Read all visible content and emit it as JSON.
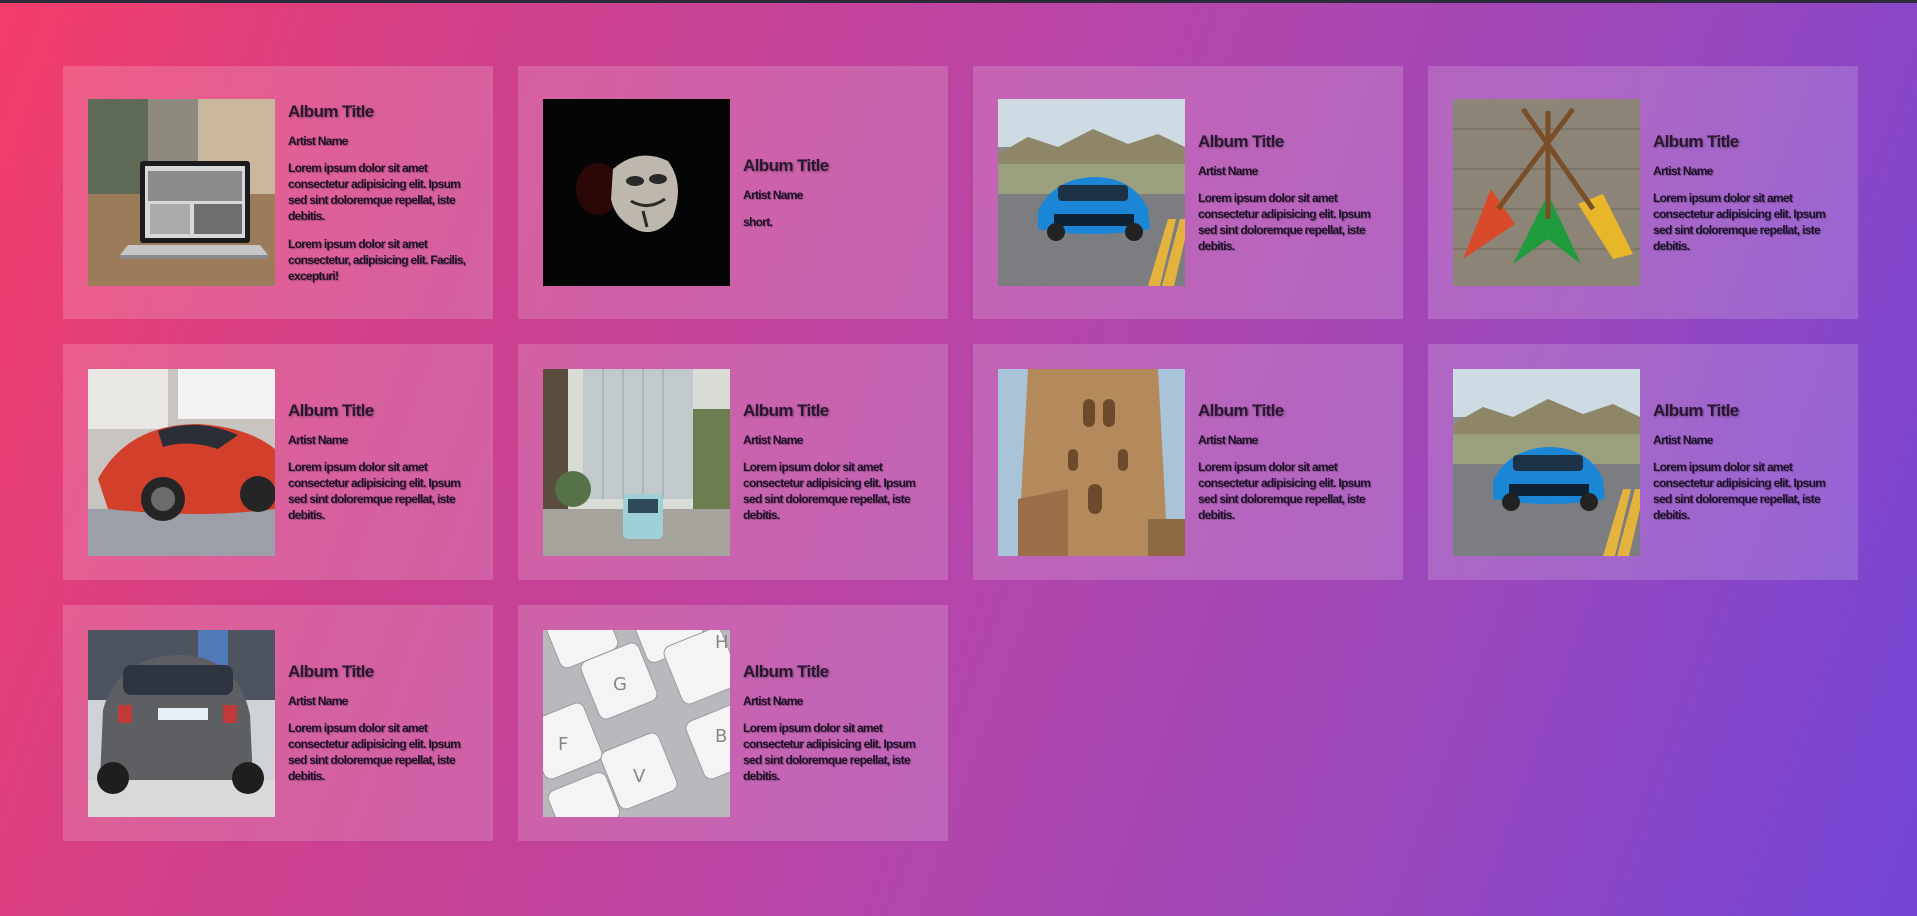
{
  "accent_colors": {
    "gradient_start": "#f43d6a",
    "gradient_end": "#7245d6",
    "card_overlay": "rgba(255,255,255,0.17)"
  },
  "cards": [
    {
      "image": "laptop-photo",
      "title": "Album Title",
      "artist": "Artist Name",
      "description": "Lorem ipsum dolor sit amet consectetur adipisicing elit. Ipsum sed sint doloremque repellat, iste debitis.",
      "description2": "Lorem ipsum dolor sit amet consectetur, adipisicing elit. Facilis, excepturi!"
    },
    {
      "image": "mask-photo",
      "title": "Album Title",
      "artist": "Artist Name",
      "description": "short."
    },
    {
      "image": "blue-car-photo",
      "title": "Album Title",
      "artist": "Artist Name",
      "description": "Lorem ipsum dolor sit amet consectetur adipisicing elit. Ipsum sed sint doloremque repellat, iste debitis."
    },
    {
      "image": "guitars-photo",
      "title": "Album Title",
      "artist": "Artist Name",
      "description": "Lorem ipsum dolor sit amet consectetur adipisicing elit. Ipsum sed sint doloremque repellat, iste debitis."
    },
    {
      "image": "red-car-photo",
      "title": "Album Title",
      "artist": "Artist Name",
      "description": "Lorem ipsum dolor sit amet consectetur adipisicing elit. Ipsum sed sint doloremque repellat, iste debitis."
    },
    {
      "image": "tram-street-photo",
      "title": "Album Title",
      "artist": "Artist Name",
      "description": "Lorem ipsum dolor sit amet consectetur adipisicing elit. Ipsum sed sint doloremque repellat, iste debitis."
    },
    {
      "image": "tower-photo",
      "title": "Album Title",
      "artist": "Artist Name",
      "description": "Lorem ipsum dolor sit amet consectetur adipisicing elit. Ipsum sed sint doloremque repellat, iste debitis."
    },
    {
      "image": "blue-car-photo",
      "title": "Album Title",
      "artist": "Artist Name",
      "description": "Lorem ipsum dolor sit amet consectetur adipisicing elit. Ipsum sed sint doloremque repellat, iste debitis."
    },
    {
      "image": "grey-car-photo",
      "title": "Album Title",
      "artist": "Artist Name",
      "description": "Lorem ipsum dolor sit amet consectetur adipisicing elit. Ipsum sed sint doloremque repellat, iste debitis."
    },
    {
      "image": "keyboard-photo",
      "title": "Album Title",
      "artist": "Artist Name",
      "description": "Lorem ipsum dolor sit amet consectetur adipisicing elit. Ipsum sed sint doloremque repellat, iste debitis.",
      "keys": [
        "G",
        "F",
        "V",
        "B",
        "H"
      ]
    }
  ]
}
